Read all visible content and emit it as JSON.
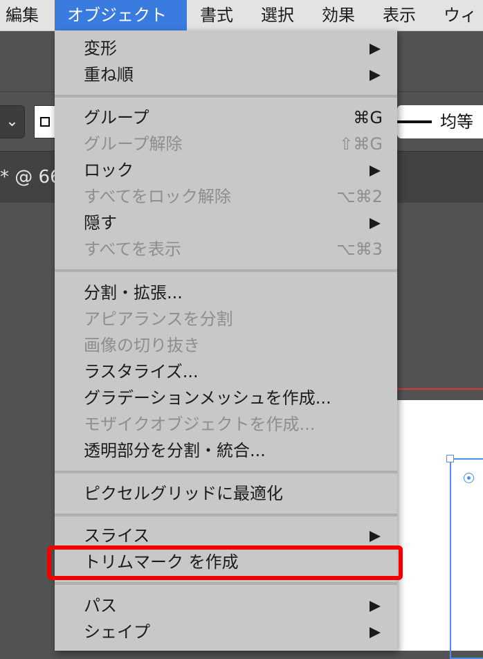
{
  "menubar": {
    "items": [
      {
        "label": "編集",
        "active": false
      },
      {
        "label": "オブジェクト",
        "active": true
      },
      {
        "label": "書式",
        "active": false
      },
      {
        "label": "選択",
        "active": false
      },
      {
        "label": "効果",
        "active": false
      },
      {
        "label": "表示",
        "active": false
      },
      {
        "label": "ウィ",
        "active": false
      }
    ]
  },
  "control_bar": {
    "stroke_profile_label": "均等"
  },
  "document_tab": {
    "label": "* @ 66"
  },
  "object_menu": {
    "items": [
      {
        "label": "変形",
        "submenu": true,
        "enabled": true
      },
      {
        "label": "重ね順",
        "submenu": true,
        "enabled": true
      },
      {
        "label": "グループ",
        "shortcut": "⌘G",
        "enabled": true
      },
      {
        "label": "グループ解除",
        "shortcut": "⇧⌘G",
        "enabled": false
      },
      {
        "label": "ロック",
        "submenu": true,
        "enabled": true
      },
      {
        "label": "すべてをロック解除",
        "shortcut": "⌥⌘2",
        "enabled": false
      },
      {
        "label": "隠す",
        "submenu": true,
        "enabled": true
      },
      {
        "label": "すべてを表示",
        "shortcut": "⌥⌘3",
        "enabled": false
      },
      {
        "label": "分割・拡張...",
        "enabled": true
      },
      {
        "label": "アピアランスを分割",
        "enabled": false
      },
      {
        "label": "画像の切り抜き",
        "enabled": false
      },
      {
        "label": "ラスタライズ...",
        "enabled": true
      },
      {
        "label": "グラデーションメッシュを作成...",
        "enabled": true
      },
      {
        "label": "モザイクオブジェクトを作成...",
        "enabled": false
      },
      {
        "label": "透明部分を分割・統合...",
        "enabled": true
      },
      {
        "label": "ピクセルグリッドに最適化",
        "enabled": true
      },
      {
        "label": "スライス",
        "submenu": true,
        "enabled": true
      },
      {
        "label": "トリムマーク を作成",
        "enabled": true,
        "highlighted": true
      },
      {
        "label": "パス",
        "submenu": true,
        "enabled": true
      },
      {
        "label": "シェイプ",
        "submenu": true,
        "enabled": true
      }
    ]
  },
  "colors": {
    "menubar_active": "#3a7be0",
    "highlight_outline": "#f00000",
    "selection": "#4a8ef0",
    "menu_bg": "#c8c8c8"
  }
}
